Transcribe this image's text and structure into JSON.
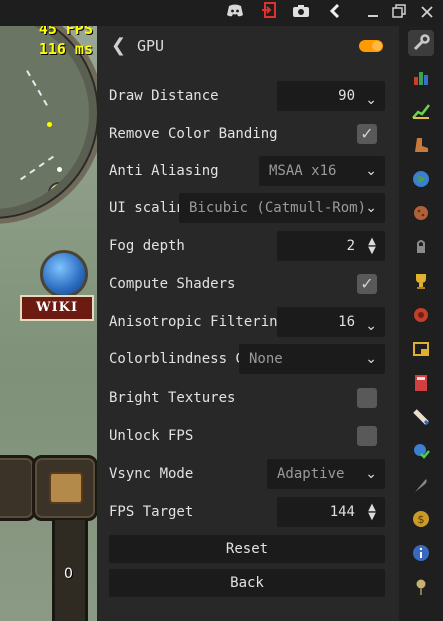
{
  "game": {
    "fps": "45 FPS",
    "ms": "116 ms",
    "wiki": "WIKI",
    "counter": "0"
  },
  "topbar": {
    "icons": [
      "discord-icon",
      "logout-icon",
      "camera-icon",
      "back-arrow-icon",
      "minimize-icon",
      "restore-icon",
      "close-icon"
    ]
  },
  "panel": {
    "title": "GPU",
    "enabled": true,
    "settings": {
      "draw_distance": {
        "label": "Draw Distance",
        "value": "90"
      },
      "remove_banding": {
        "label": "Remove Color Banding",
        "checked": true
      },
      "anti_aliasing": {
        "label": "Anti Aliasing",
        "value": "MSAA x16"
      },
      "ui_scaling": {
        "label": "UI scalin...",
        "value": "Bicubic (Catmull-Rom)"
      },
      "fog_depth": {
        "label": "Fog depth",
        "value": "2"
      },
      "compute_shaders": {
        "label": "Compute Shaders",
        "checked": true
      },
      "anisotropic": {
        "label": "Anisotropic Filtering",
        "value": "16"
      },
      "colorblindness": {
        "label": "Colorblindness C...",
        "value": "None"
      },
      "bright_textures": {
        "label": "Bright Textures",
        "checked": false
      },
      "unlock_fps": {
        "label": "Unlock FPS",
        "checked": false
      },
      "vsync": {
        "label": "Vsync Mode",
        "value": "Adaptive"
      },
      "fps_target": {
        "label": "FPS Target",
        "value": "144"
      }
    },
    "reset_label": "Reset",
    "back_label": "Back"
  },
  "sidebar": {
    "icons": [
      "wrench-icon",
      "stats-bar-icon",
      "xp-graph-icon",
      "boot-icon",
      "globe-icon",
      "cookie-icon",
      "lock-icon",
      "trophy-icon",
      "puzzle-icon",
      "camera-frame-icon",
      "calculator-icon",
      "scroll-icon",
      "world-check-icon",
      "feather-icon",
      "coin-icon",
      "info-icon",
      "pin-icon"
    ]
  },
  "colors": {
    "accent": "#ff9a00",
    "panel_bg": "#282828",
    "field_bg": "#1b1b1b",
    "fps_text": "#ffff00"
  }
}
